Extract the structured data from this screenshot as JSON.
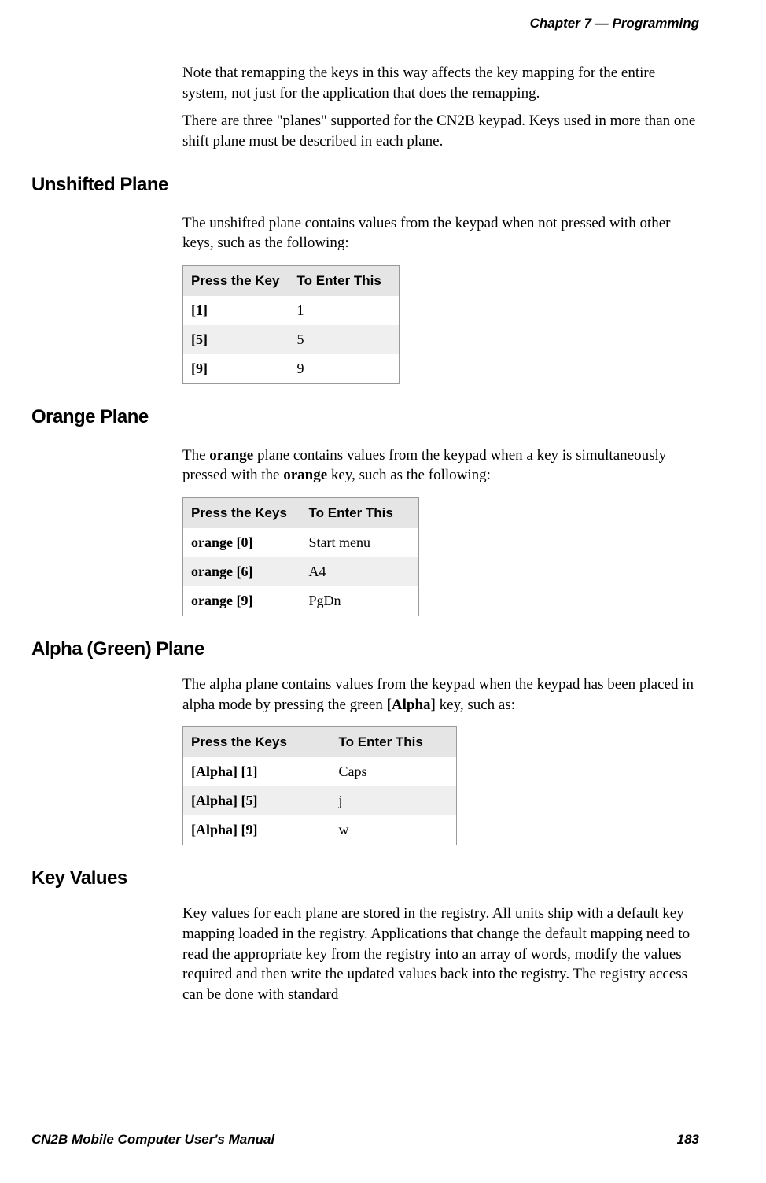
{
  "header": "Chapter 7 —  Programming",
  "intro_p1": "Note that remapping the keys in this way affects the key mapping for the entire system, not just for the application that does the remapping.",
  "intro_p2": "There are three \"planes\" supported for the CN2B keypad. Keys used in more than one shift plane must be described in each plane.",
  "section1": {
    "heading": "Unshifted Plane",
    "body": "The unshifted plane contains values from the keypad when not pressed with other keys, such as the following:",
    "table": {
      "h1": "Press the Key",
      "h2": "To Enter This",
      "r1c1": "[1]",
      "r1c2": "1",
      "r2c1": "[5]",
      "r2c2": "5",
      "r3c1": "[9]",
      "r3c2": "9"
    }
  },
  "section2": {
    "heading": "Orange Plane",
    "body_pre": "The ",
    "body_b1": "orange",
    "body_mid": " plane contains values from the keypad when a key is simultaneously pressed with the ",
    "body_b2": "orange",
    "body_post": " key, such as the following:",
    "table": {
      "h1": "Press the Keys",
      "h2": "To Enter This",
      "r1c1a": "orange",
      "r1c1b": " [0]",
      "r1c2": "Start menu",
      "r2c1a": "orange",
      "r2c1b": " [6]",
      "r2c2": "A4",
      "r3c1a": "orange",
      "r3c1b": " [9]",
      "r3c2": "PgDn"
    }
  },
  "section3": {
    "heading": "Alpha (Green) Plane",
    "body_pre": "The alpha plane contains values from the keypad when the keypad has been placed in alpha mode by pressing the green ",
    "body_b": "[Alpha]",
    "body_post": " key, such as:",
    "table": {
      "h1": "Press the Keys",
      "h2": "To Enter This",
      "r1c1": "[Alpha] [1]",
      "r1c2": "Caps",
      "r2c1": "[Alpha] [5]",
      "r2c2": "j",
      "r3c1": "[Alpha] [9]",
      "r3c2": "w"
    }
  },
  "section4": {
    "heading": "Key Values",
    "body": "Key values for each plane are stored in the registry. All units ship with a default key mapping loaded in the registry. Applications that change the default mapping need to read the appropriate key from the registry into an array of words, modify the values required and then write the updated values back into the registry. The registry access can be done with standard"
  },
  "footer": {
    "left": "CN2B Mobile Computer User's Manual",
    "right": "183"
  }
}
